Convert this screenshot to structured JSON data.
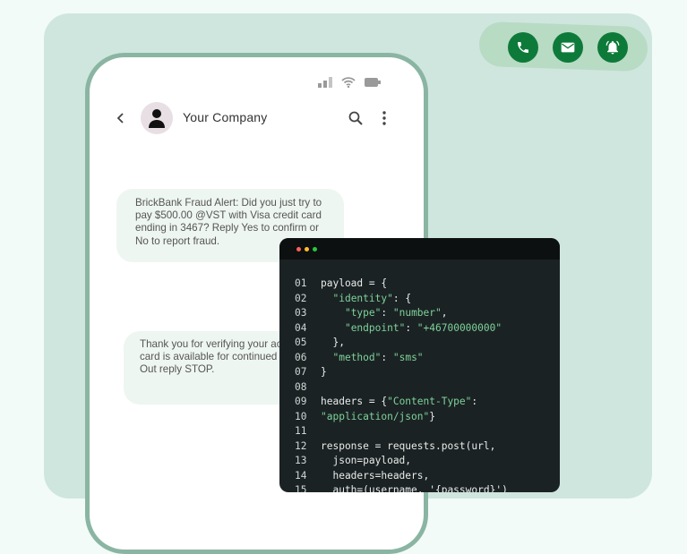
{
  "actions": {
    "call_icon": "phone-icon",
    "mail_icon": "mail-icon",
    "alert_icon": "bell-icon",
    "accent": "#0e7a3a"
  },
  "phone": {
    "contact_name": "Your Company",
    "messages": [
      {
        "text": "BrickBank Fraud Alert: Did you just try to pay $500.00 @VST with Visa credit card ending in 3467? Reply Yes to confirm or No to report fraud."
      },
      {
        "text": "Thank you for verifying your activity. Your card is available for continued use. To Opt Out reply STOP."
      }
    ]
  },
  "code": {
    "window_dots": [
      "#ff5f56",
      "#ffbd2e",
      "#27c93f"
    ],
    "lines": [
      {
        "n": "01",
        "segs": [
          [
            "payload = {",
            ""
          ]
        ]
      },
      {
        "n": "02",
        "segs": [
          [
            "  ",
            ""
          ],
          [
            "\"identity\"",
            "s"
          ],
          [
            ": {",
            ""
          ]
        ]
      },
      {
        "n": "03",
        "segs": [
          [
            "    ",
            ""
          ],
          [
            "\"type\"",
            "s"
          ],
          [
            ": ",
            ""
          ],
          [
            "\"number\"",
            "s"
          ],
          [
            ",",
            ""
          ]
        ]
      },
      {
        "n": "04",
        "segs": [
          [
            "    ",
            ""
          ],
          [
            "\"endpoint\"",
            "s"
          ],
          [
            ": ",
            ""
          ],
          [
            "\"+46700000000\"",
            "s"
          ]
        ]
      },
      {
        "n": "05",
        "segs": [
          [
            "  },",
            ""
          ]
        ]
      },
      {
        "n": "06",
        "segs": [
          [
            "  ",
            ""
          ],
          [
            "\"method\"",
            "s"
          ],
          [
            ": ",
            ""
          ],
          [
            "\"sms\"",
            "s"
          ]
        ]
      },
      {
        "n": "07",
        "segs": [
          [
            "}",
            ""
          ]
        ]
      },
      {
        "n": "08",
        "segs": [
          [
            "",
            ""
          ]
        ]
      },
      {
        "n": "09",
        "segs": [
          [
            "headers = {",
            ""
          ],
          [
            "\"Content-Type\"",
            "s"
          ],
          [
            ":",
            ""
          ]
        ]
      },
      {
        "n": "10",
        "segs": [
          [
            "\"application/json\"",
            "s"
          ],
          [
            "}",
            ""
          ]
        ]
      },
      {
        "n": "11",
        "segs": [
          [
            "",
            ""
          ]
        ]
      },
      {
        "n": "12",
        "segs": [
          [
            "response = requests.post(url,",
            ""
          ]
        ]
      },
      {
        "n": "13",
        "segs": [
          [
            "  json=payload,",
            ""
          ]
        ]
      },
      {
        "n": "14",
        "segs": [
          [
            "  headers=headers,",
            ""
          ]
        ]
      },
      {
        "n": "15",
        "segs": [
          [
            "  auth=(username, '{password}')",
            ""
          ]
        ]
      }
    ]
  }
}
